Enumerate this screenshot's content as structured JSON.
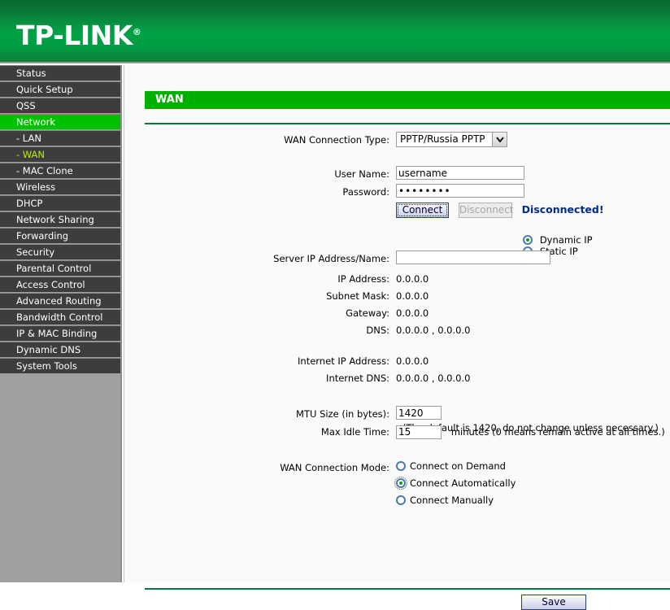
{
  "brand": {
    "logo_text": "TP-LINK",
    "logo_mark": "®"
  },
  "sidebar": {
    "items": [
      {
        "label": "Status",
        "state": "normal"
      },
      {
        "label": "Quick Setup",
        "state": "normal"
      },
      {
        "label": "QSS",
        "state": "normal"
      },
      {
        "label": "Network",
        "state": "active"
      },
      {
        "label": "- LAN",
        "state": "sub"
      },
      {
        "label": "- WAN",
        "state": "sub-current"
      },
      {
        "label": "- MAC Clone",
        "state": "sub"
      },
      {
        "label": "Wireless",
        "state": "normal"
      },
      {
        "label": "DHCP",
        "state": "normal"
      },
      {
        "label": "Network Sharing",
        "state": "normal"
      },
      {
        "label": "Forwarding",
        "state": "normal"
      },
      {
        "label": "Security",
        "state": "normal"
      },
      {
        "label": "Parental Control",
        "state": "normal"
      },
      {
        "label": "Access Control",
        "state": "normal"
      },
      {
        "label": "Advanced Routing",
        "state": "normal"
      },
      {
        "label": "Bandwidth Control",
        "state": "normal"
      },
      {
        "label": "IP & MAC Binding",
        "state": "normal"
      },
      {
        "label": "Dynamic DNS",
        "state": "normal"
      },
      {
        "label": "System Tools",
        "state": "normal"
      }
    ]
  },
  "page": {
    "title": "WAN"
  },
  "form": {
    "connection_type_label": "WAN Connection Type:",
    "connection_type_value": "PPTP/Russia PPTP",
    "username_label": "User Name:",
    "username_value": "username",
    "password_label": "Password:",
    "password_value": "••••••••",
    "connect_label": "Connect",
    "disconnect_label": "Disconnect",
    "status_text": "Disconnected!",
    "ip_mode": {
      "dynamic_label": "Dynamic IP",
      "static_label": "Static IP",
      "selected": "dynamic"
    },
    "server_ip_label": "Server IP Address/Name:",
    "server_ip_value": "",
    "readonly_rows": [
      {
        "label": "IP Address:",
        "value": "0.0.0.0"
      },
      {
        "label": "Subnet Mask:",
        "value": "0.0.0.0"
      },
      {
        "label": "Gateway:",
        "value": "0.0.0.0"
      },
      {
        "label": "DNS:",
        "value": "0.0.0.0 , 0.0.0.0"
      }
    ],
    "internet_rows": [
      {
        "label": "Internet IP Address:",
        "value": "0.0.0.0"
      },
      {
        "label": "Internet DNS:",
        "value": "0.0.0.0 , 0.0.0.0"
      }
    ],
    "mtu_label": "MTU Size (in bytes):",
    "mtu_value": "1420",
    "mtu_hint": "(The default is 1420, do not change unless necessary.)",
    "idle_label": "Max Idle Time:",
    "idle_value": "15",
    "idle_hint": "minutes (0 means remain active at all times.)",
    "mode_label": "WAN Connection Mode:",
    "modes": [
      {
        "label": "Connect on Demand",
        "selected": false
      },
      {
        "label": "Connect Automatically",
        "selected": true
      },
      {
        "label": "Connect Manually",
        "selected": false
      }
    ],
    "save_label": "Save"
  },
  "colors": {
    "brand_green": "#00a346",
    "title_green": "#00b000",
    "active_nav": "#00c000",
    "sub_current": "#b8f000",
    "status_blue": "#002b8c"
  }
}
